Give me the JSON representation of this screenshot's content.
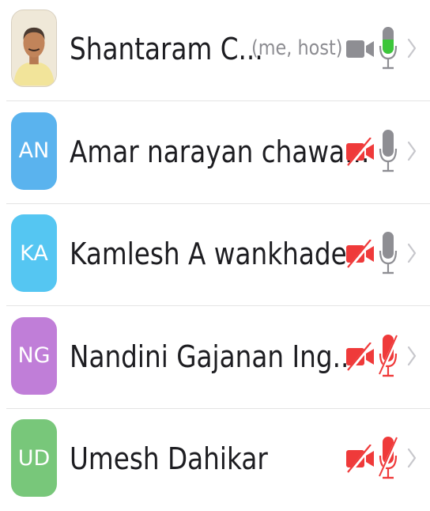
{
  "colors": {
    "muted_red": "#ef3a3a",
    "icon_gray": "#8e8e93",
    "chevron_gray": "#c7c7cc",
    "mic_active_green": "#3cc63a"
  },
  "participants": [
    {
      "name": "Shantaram C...",
      "tag": "(me, host)",
      "avatar_initials": "",
      "avatar_type": "photo",
      "avatar_color": "#f0e6d2",
      "video_muted": false,
      "audio_muted": false,
      "speaking": true
    },
    {
      "name": "Amar narayan chawa...",
      "tag": "",
      "avatar_initials": "AN",
      "avatar_type": "initials",
      "avatar_color": "#5ab3ee",
      "video_muted": true,
      "audio_muted": false,
      "speaking": false
    },
    {
      "name": "Kamlesh A wankhade",
      "tag": "",
      "avatar_initials": "KA",
      "avatar_type": "initials",
      "avatar_color": "#55c6f2",
      "video_muted": true,
      "audio_muted": false,
      "speaking": false
    },
    {
      "name": "Nandini Gajanan Ing...",
      "tag": "",
      "avatar_initials": "NG",
      "avatar_type": "initials",
      "avatar_color": "#c07ed8",
      "video_muted": true,
      "audio_muted": true,
      "speaking": false
    },
    {
      "name": "Umesh Dahikar",
      "tag": "",
      "avatar_initials": "UD",
      "avatar_type": "initials",
      "avatar_color": "#78c77a",
      "video_muted": true,
      "audio_muted": true,
      "speaking": false
    }
  ]
}
